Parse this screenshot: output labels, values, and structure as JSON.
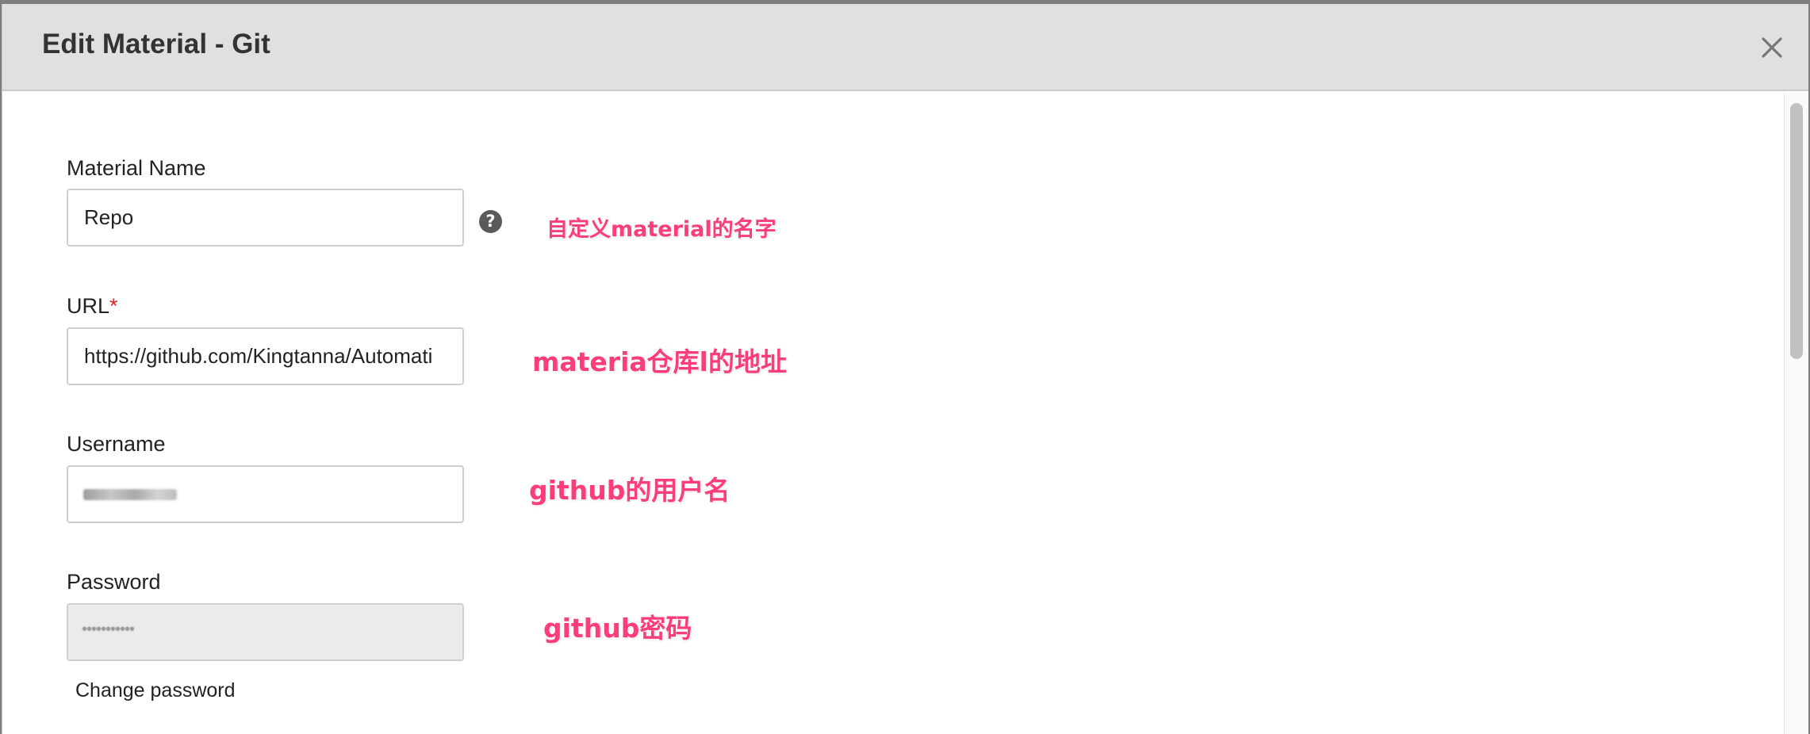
{
  "dialog": {
    "title": "Edit Material - Git"
  },
  "icons": {
    "close": "close-icon",
    "help": "question-circle-icon"
  },
  "fields": {
    "material_name": {
      "label": "Material Name",
      "value": "Repo"
    },
    "url": {
      "label": "URL",
      "required_marker": "*",
      "value": "https://github.com/Kingtanna/Automati"
    },
    "username": {
      "label": "Username"
    },
    "password": {
      "label": "Password",
      "change_link": "Change password"
    }
  },
  "annotations": {
    "material_name": "自定义material的名字",
    "url": "materia仓库l的地址",
    "username": "github的用户名",
    "password": "github密码"
  },
  "colors": {
    "annotation": "#fb3d79",
    "header_bg": "#e0e0e0",
    "required": "#e02424"
  }
}
